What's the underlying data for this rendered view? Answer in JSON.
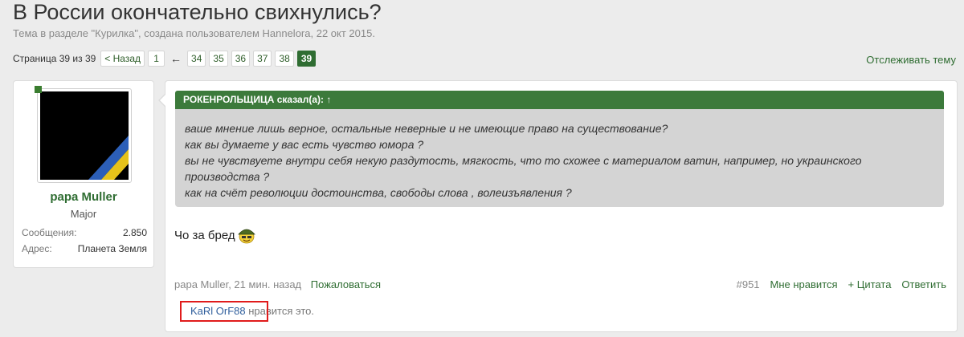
{
  "thread": {
    "title": "В России окончательно свихнулись?",
    "subtitle": "Тема в разделе \"Курилка\", создана пользователем Hannelora, 22 окт 2015."
  },
  "pager": {
    "label": "Страница 39 из 39",
    "prev": "< Назад",
    "first": "1",
    "ellipsis_arrow": "←",
    "pages": [
      "34",
      "35",
      "36",
      "37",
      "38"
    ],
    "current": "39"
  },
  "watch_label": "Отслеживать тему",
  "user": {
    "name": "papa Muller",
    "rank": "Major",
    "stats": [
      {
        "key": "Сообщения:",
        "value": "2.850"
      },
      {
        "key": "Адрес:",
        "value": "Планета Земля"
      }
    ]
  },
  "quote": {
    "header": "РОКЕНРОЛЬЩИЦА сказал(а): ↑",
    "lines": [
      "ваше мнение лишь верное, остальные неверные и не имеющие право на существование?",
      "как вы думаете у вас есть чувство юмора ?",
      "вы не чувствуете внутри себя некую раздутость, мягкость, что то схожее с материалом ватин, например, но украинского",
      "производства ?",
      "как на счёт революции достоинства, свободы слова , волеизъявления ?"
    ]
  },
  "post": {
    "text": "Чо за бред",
    "meta": "papa Muller, 21 мин. назад",
    "report": "Пожаловаться",
    "number": "#951",
    "like": "Мне нравится",
    "quote_btn": "+ Цитата",
    "reply": "Ответить"
  },
  "likes": {
    "user": "KaRl OrF88",
    "suffix": " нравится это."
  },
  "colors": {
    "accent": "#2f6d32",
    "quote_header": "#3c7a3b",
    "highlight": "#e01b1b"
  }
}
